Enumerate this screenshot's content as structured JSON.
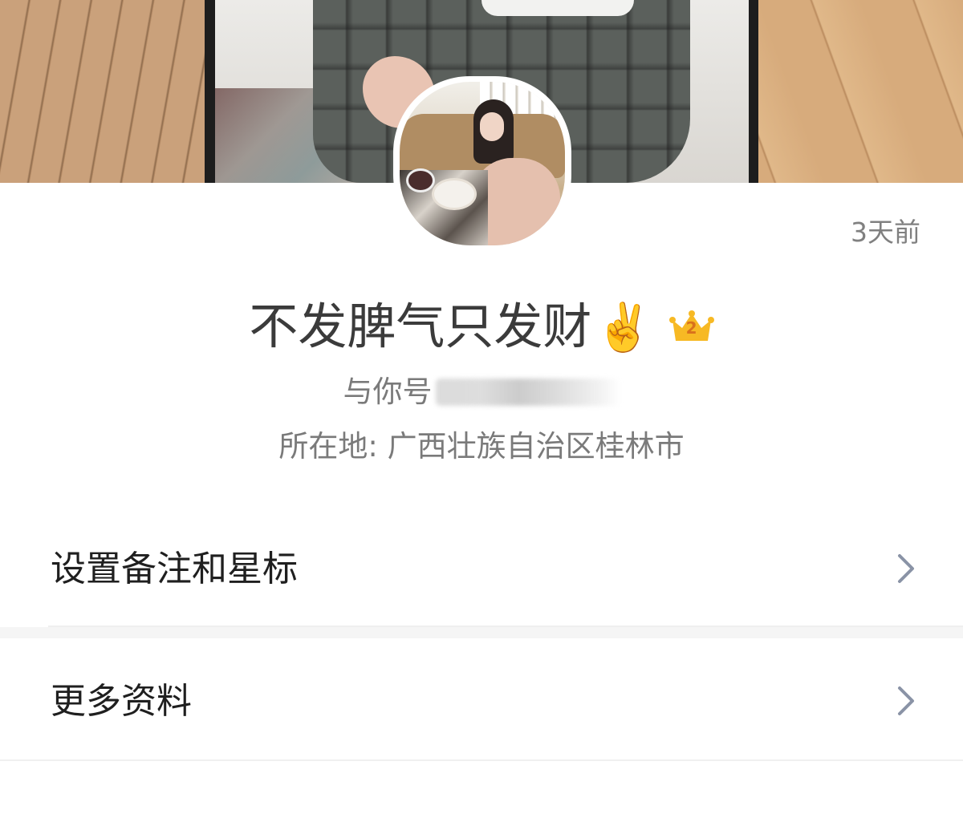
{
  "profile": {
    "time_ago": "3天前",
    "nickname": "不发脾气只发财",
    "nickname_emoji": "✌️",
    "vip_level": "2",
    "account_label": "与你号",
    "location": "所在地: 广西壮族自治区桂林市"
  },
  "menu": {
    "remark_label": "设置备注和星标",
    "more_info_label": "更多资料"
  },
  "icons": {
    "crown": "crown-icon",
    "chevron": "chevron-right-icon"
  },
  "colors": {
    "crown_gold": "#f7b924",
    "crown_number": "#d9711c",
    "chevron": "#8a93a6"
  }
}
